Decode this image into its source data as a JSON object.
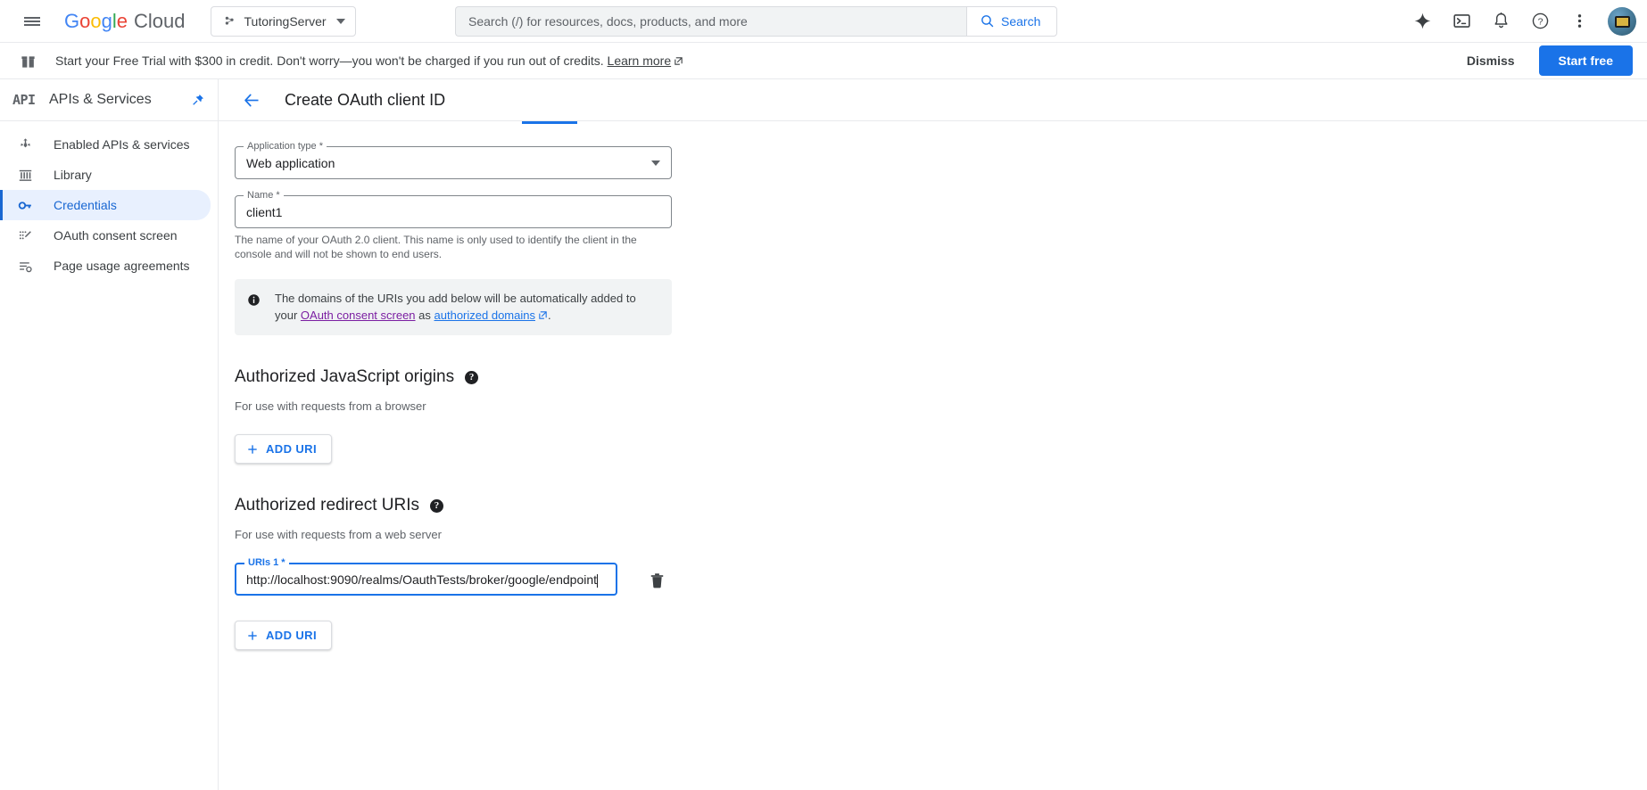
{
  "topbar": {
    "menu_icon": "hamburger-icon",
    "logo": {
      "google": "Google",
      "cloud": "Cloud"
    },
    "project": "TutoringServer",
    "search": {
      "placeholder": "Search (/) for resources, docs, products, and more",
      "button_label": "Search"
    },
    "icons": [
      "gemini-sparkle-icon",
      "cloud-shell-terminal-icon",
      "notifications-bell-icon",
      "help-question-icon",
      "more-options-kebab-icon",
      "account-avatar"
    ]
  },
  "banner": {
    "icon": "gift-icon",
    "text": "Start your Free Trial with $300 in credit. Don't worry—you won't be charged if you run out of credits.",
    "learn_more": "Learn more",
    "dismiss": "Dismiss",
    "start_free": "Start free",
    "accent_color": "#1a73e8"
  },
  "sidebar": {
    "product_logo": "API",
    "title": "APIs & Services",
    "pin_icon": "pin-icon",
    "items": [
      {
        "label": "Enabled APIs & services",
        "icon": "enabled-apis-icon",
        "selected": false
      },
      {
        "label": "Library",
        "icon": "library-icon",
        "selected": false
      },
      {
        "label": "Credentials",
        "icon": "key-icon",
        "selected": true
      },
      {
        "label": "OAuth consent screen",
        "icon": "consent-screen-icon",
        "selected": false
      },
      {
        "label": "Page usage agreements",
        "icon": "agreements-icon",
        "selected": false
      }
    ],
    "selected_color": "#1967d2"
  },
  "main": {
    "back_icon": "back-arrow-icon",
    "page_title": "Create OAuth client ID",
    "application_type": {
      "label": "Application type *",
      "value": "Web application"
    },
    "name": {
      "label": "Name *",
      "value": "client1",
      "helper": "The name of your OAuth 2.0 client. This name is only used to identify the client in the console and will not be shown to end users."
    },
    "info": {
      "icon": "info-icon",
      "text_before": "The domains of the URIs you add below will be automatically added to your ",
      "link1": "OAuth consent screen",
      "text_middle": " as ",
      "link2": "authorized domains",
      "text_after": "."
    },
    "javascript_origins": {
      "title": "Authorized JavaScript origins",
      "help_icon": "help-circle-icon",
      "subtitle": "For use with requests from a browser",
      "add_uri_label": "ADD URI"
    },
    "redirect_uris": {
      "title": "Authorized redirect URIs",
      "help_icon": "help-circle-icon",
      "subtitle": "For use with requests from a web server",
      "uri_field": {
        "label": "URIs 1 *",
        "value": "http://localhost:9090/realms/OauthTests/broker/google/endpoint"
      },
      "delete_icon": "trash-icon",
      "add_uri_label": "ADD URI"
    }
  }
}
